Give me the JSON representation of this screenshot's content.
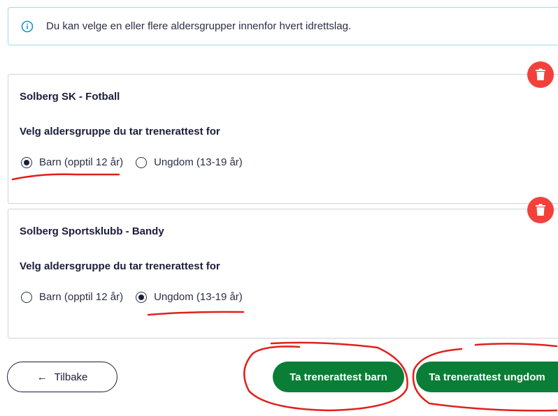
{
  "info": {
    "text": "Du kan velge en eller flere aldersgrupper innenfor hvert idrettslag."
  },
  "cards": [
    {
      "title": "Solberg SK - Fotball",
      "question": "Velg aldersgruppe du tar trenerattest for",
      "options": [
        {
          "label": "Barn (opptil 12 år)",
          "selected": true
        },
        {
          "label": "Ungdom (13-19 år)",
          "selected": false
        }
      ]
    },
    {
      "title": "Solberg Sportsklubb - Bandy",
      "question": "Velg aldersgruppe du tar trenerattest for",
      "options": [
        {
          "label": "Barn (opptil 12 år)",
          "selected": false
        },
        {
          "label": "Ungdom (13-19 år)",
          "selected": true
        }
      ]
    }
  ],
  "actions": {
    "back_arrow": "←",
    "back_label": "Tilbake",
    "barn_label": "Ta trenerattest barn",
    "ungdom_label": "Ta trenerattest ungdom"
  },
  "colors": {
    "primary": "#0a7e36",
    "danger": "#f2413b",
    "info_border": "#9fd8ea",
    "annotation": "#e0201c"
  },
  "icons": {
    "info": "info-circle-icon",
    "delete": "trash-icon",
    "back": "arrow-left-icon"
  }
}
